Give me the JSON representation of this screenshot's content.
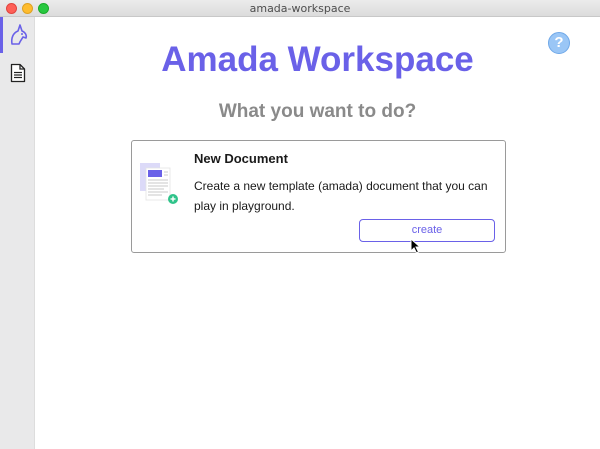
{
  "window": {
    "title": "amada-workspace"
  },
  "sidebar": {
    "items": [
      {
        "icon": "unicorn-logo-icon",
        "active": true
      },
      {
        "icon": "document-icon",
        "active": false
      }
    ]
  },
  "help": {
    "label": "?"
  },
  "main": {
    "title": "Amada Workspace",
    "subtitle": "What you want to do?",
    "card": {
      "title": "New Document",
      "description": "Create a new template (amada) document that you can play in playground.",
      "button_label": "create",
      "illustration": "new-document-illustration"
    }
  },
  "colors": {
    "accent": "#6a61e8",
    "subtitle": "#8a8a8a",
    "help": "#9ac6f6",
    "add_badge": "#2fc38a"
  }
}
